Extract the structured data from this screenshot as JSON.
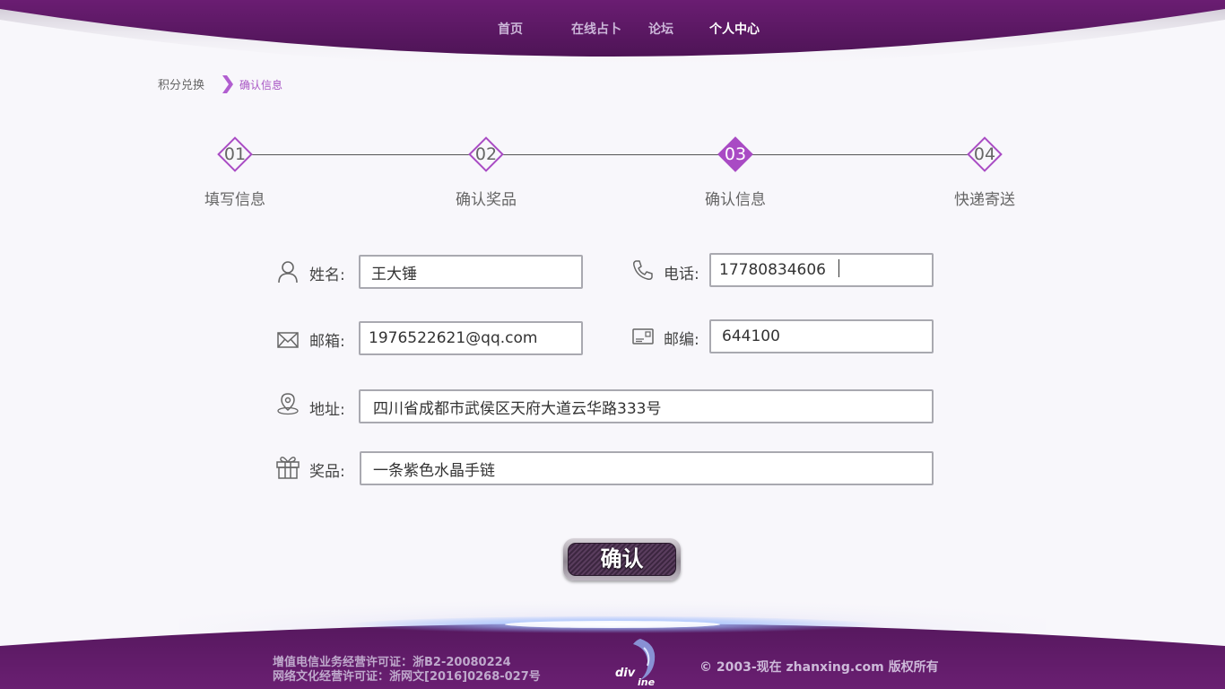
{
  "nav": {
    "items": [
      {
        "label": "首页"
      },
      {
        "label": "在线占卜"
      },
      {
        "label": "论坛"
      },
      {
        "label": "个人中心"
      }
    ]
  },
  "breadcrumb": {
    "parent": "积分兑换",
    "current": "确认信息"
  },
  "steps": [
    {
      "num": "01",
      "label": "填写信息"
    },
    {
      "num": "02",
      "label": "确认奖品"
    },
    {
      "num": "03",
      "label": "确认信息"
    },
    {
      "num": "04",
      "label": "快递寄送"
    }
  ],
  "current_step": 3,
  "form": {
    "name": {
      "label": "姓名:",
      "value": "王大锤",
      "icon": "user-icon"
    },
    "phone": {
      "label": "电话:",
      "value": "17780834606",
      "icon": "phone-icon"
    },
    "email": {
      "label": "邮箱:",
      "value": "1976522621@qq.com",
      "icon": "mail-icon"
    },
    "postcode": {
      "label": "邮编:",
      "value": "644100",
      "icon": "postcode-icon"
    },
    "address": {
      "label": "地址:",
      "value": "四川省成都市武侯区天府大道云华路333号",
      "icon": "location-icon"
    },
    "prize": {
      "label": "奖品:",
      "value": "一条紫色水晶手链",
      "icon": "gift-icon"
    }
  },
  "confirm_button": "确认",
  "footer": {
    "license_1": "增值电信业务经营许可证：浙B2-20080224",
    "license_2": "网络文化经营许可证：浙网文[2016]0268-027号",
    "logo_text": "divine",
    "copyright": "© 2003-现在 zhanxing.com 版权所有"
  },
  "colors": {
    "brand_purple": "#5e1a66",
    "accent": "#a94bc4"
  }
}
